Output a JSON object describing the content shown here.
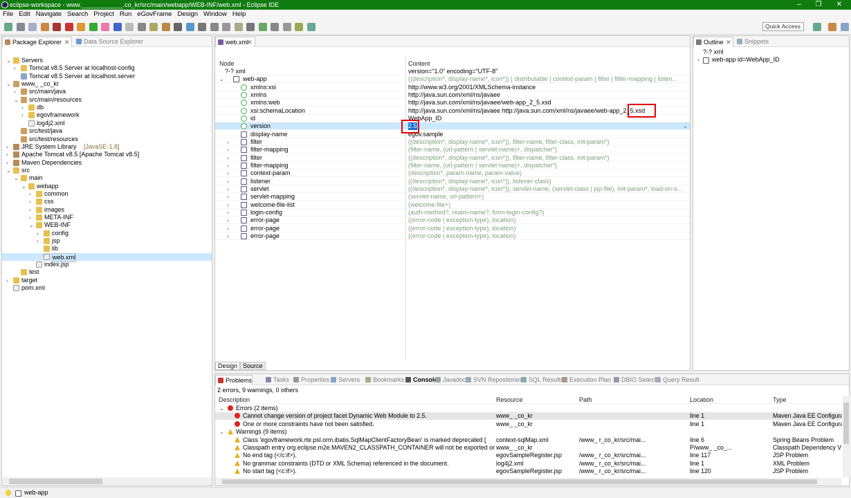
{
  "window": {
    "title": "eclipse-workspace - www.____________.co_kr/src/main/webapp/WEB-INF/web.xml - Eclipse IDE",
    "minimize": "–",
    "restore": "❐",
    "close": "✕"
  },
  "menu": [
    "File",
    "Edit",
    "Navigate",
    "Search",
    "Project",
    "Run",
    "eGovFrame",
    "Design",
    "Window",
    "Help"
  ],
  "quick_access": "Quick Access",
  "left_tabs": {
    "package_explorer": "Package Explorer",
    "data_source_explorer": "Data Source Explorer"
  },
  "tree": [
    {
      "label": "Servers",
      "indent": 0,
      "chev": "v",
      "icon": "fold"
    },
    {
      "label": "Tomcat v8.5 Server at localhost-config",
      "indent": 1,
      "chev": ">",
      "icon": "fold"
    },
    {
      "label": "Tomcat v8.5 Server at localhost.server",
      "indent": 1,
      "chev": "",
      "icon": "srv"
    },
    {
      "label": "www_              _co_kr",
      "indent": 0,
      "chev": "v",
      "icon": "pkg"
    },
    {
      "label": "src/main/java",
      "indent": 1,
      "chev": ">",
      "icon": "pkg"
    },
    {
      "label": "src/main/resources",
      "indent": 1,
      "chev": "v",
      "icon": "pkg"
    },
    {
      "label": "db",
      "indent": 2,
      "chev": ">",
      "icon": "fold"
    },
    {
      "label": "egovframework",
      "indent": 2,
      "chev": ">",
      "icon": "fold"
    },
    {
      "label": "log4j2.xml",
      "indent": 2,
      "chev": "",
      "icon": "fileic"
    },
    {
      "label": "src/test/java",
      "indent": 1,
      "chev": "",
      "icon": "pkg"
    },
    {
      "label": "src/test/resources",
      "indent": 1,
      "chev": "",
      "icon": "pkg"
    },
    {
      "label": "JRE System Library",
      "extra": "[JavaSE-1.8]",
      "indent": 0,
      "chev": ">",
      "icon": "jar"
    },
    {
      "label": "Apache Tomcat v8.5 [Apache Tomcat v8.5]",
      "indent": 0,
      "chev": ">",
      "icon": "jar"
    },
    {
      "label": "Maven Dependencies",
      "indent": 0,
      "chev": ">",
      "icon": "jar"
    },
    {
      "label": "src",
      "indent": 0,
      "chev": "v",
      "icon": "fold"
    },
    {
      "label": "main",
      "indent": 1,
      "chev": "v",
      "icon": "fold"
    },
    {
      "label": "webapp",
      "indent": 2,
      "chev": "v",
      "icon": "fold"
    },
    {
      "label": "common",
      "indent": 3,
      "chev": ">",
      "icon": "fold"
    },
    {
      "label": "css",
      "indent": 3,
      "chev": ">",
      "icon": "fold"
    },
    {
      "label": "images",
      "indent": 3,
      "chev": ">",
      "icon": "fold"
    },
    {
      "label": "META-INF",
      "indent": 3,
      "chev": ">",
      "icon": "fold"
    },
    {
      "label": "WEB-INF",
      "indent": 3,
      "chev": "v",
      "icon": "fold"
    },
    {
      "label": "config",
      "indent": 4,
      "chev": ">",
      "icon": "fold"
    },
    {
      "label": "jsp",
      "indent": 4,
      "chev": ">",
      "icon": "fold"
    },
    {
      "label": "lib",
      "indent": 4,
      "chev": "",
      "icon": "fold"
    },
    {
      "label": "web.xml",
      "indent": 4,
      "chev": "",
      "icon": "fileic",
      "selected": true
    },
    {
      "label": "index.jsp",
      "indent": 3,
      "chev": "",
      "icon": "fileic"
    },
    {
      "label": "test",
      "indent": 1,
      "chev": "",
      "icon": "fold"
    },
    {
      "label": "target",
      "indent": 0,
      "chev": ">",
      "icon": "fold"
    },
    {
      "label": "pom.xml",
      "indent": 0,
      "chev": "",
      "icon": "fileic"
    }
  ],
  "editor": {
    "tab": "web.xml",
    "col_node": "Node",
    "col_content": "Content",
    "bottom_tabs": [
      "Design",
      "Source"
    ],
    "rows": [
      {
        "node": "?-? xml",
        "content": "version=\"1.0\" encoding=\"UTF-8\"",
        "indent": 0,
        "chev": "",
        "kind": "pi"
      },
      {
        "node": "web-app",
        "content": "((description*, display-name*, icon*)) | distributable | context-param | filter | filter-mapping | listen...",
        "indent": 0,
        "chev": "v",
        "kind": "el",
        "gray": true
      },
      {
        "node": "xmlns:xsi",
        "content": "http://www.w3.org/2001/XMLSchema-instance",
        "indent": 1,
        "chev": "",
        "kind": "at"
      },
      {
        "node": "xmlns",
        "content": "http://java.sun.com/xml/ns/javaee",
        "indent": 1,
        "chev": "",
        "kind": "at"
      },
      {
        "node": "xmlns:web",
        "content": "http://java.sun.com/xml/ns/javaee/web-app_2_5.xsd",
        "indent": 1,
        "chev": "",
        "kind": "at"
      },
      {
        "node": "xsi:schemaLocation",
        "content": "http://java.sun.com/xml/ns/javaee http://java.sun.com/xml/ns/javaee/web-app_2_5.xsd",
        "indent": 1,
        "chev": "",
        "kind": "at"
      },
      {
        "node": "id",
        "content": "WebApp_ID",
        "indent": 1,
        "chev": "",
        "kind": "at"
      },
      {
        "node": "version",
        "content": "2.5",
        "indent": 1,
        "chev": "",
        "kind": "at",
        "selected": true
      },
      {
        "node": "display-name",
        "content": "egov.sample",
        "indent": 1,
        "chev": "",
        "kind": "el"
      },
      {
        "node": "filter",
        "content": "((description*, display-name*, icon*)), filter-name, filter-class, init-param*)",
        "indent": 1,
        "chev": ">",
        "kind": "el",
        "gray": true
      },
      {
        "node": "filter-mapping",
        "content": "(filter-name, (url-pattern | servlet-name)+, dispatcher*)",
        "indent": 1,
        "chev": ">",
        "kind": "el",
        "gray": true
      },
      {
        "node": "filter",
        "content": "((description*, display-name*, icon*)), filter-name, filter-class, init-param*)",
        "indent": 1,
        "chev": ">",
        "kind": "el",
        "gray": true
      },
      {
        "node": "filter-mapping",
        "content": "(filter-name, (url-pattern | servlet-name)+, dispatcher*)",
        "indent": 1,
        "chev": ">",
        "kind": "el",
        "gray": true
      },
      {
        "node": "context-param",
        "content": "(description*, param-name, param-value)",
        "indent": 1,
        "chev": ">",
        "kind": "el",
        "gray": true
      },
      {
        "node": "listener",
        "content": "((description*, display-name*, icon*)), listener-class)",
        "indent": 1,
        "chev": ">",
        "kind": "el",
        "gray": true
      },
      {
        "node": "servlet",
        "content": "((description*, display-name*, icon*)), servlet-name, (servlet-class | jsp-file), init-param*, load-on-s...",
        "indent": 1,
        "chev": ">",
        "kind": "el",
        "gray": true
      },
      {
        "node": "servlet-mapping",
        "content": "(servlet-name, url-pattern+)",
        "indent": 1,
        "chev": ">",
        "kind": "el",
        "gray": true
      },
      {
        "node": "welcome-file-list",
        "content": "(welcome-file+)",
        "indent": 1,
        "chev": ">",
        "kind": "el",
        "gray": true
      },
      {
        "node": "login-config",
        "content": "(auth-method?, realm-name?, form-login-config?)",
        "indent": 1,
        "chev": ">",
        "kind": "el",
        "gray": true
      },
      {
        "node": "error-page",
        "content": "((error-code | exception-type), location)",
        "indent": 1,
        "chev": ">",
        "kind": "el",
        "gray": true
      },
      {
        "node": "error-page",
        "content": "((error-code | exception-type), location)",
        "indent": 1,
        "chev": ">",
        "kind": "el",
        "gray": true
      },
      {
        "node": "error-page",
        "content": "((error-code | exception-type), location)",
        "indent": 1,
        "chev": ">",
        "kind": "el",
        "gray": true
      }
    ]
  },
  "outline": {
    "tab": "Outline",
    "snippets_tab": "Snippets",
    "items": [
      {
        "label": "?-? xml"
      },
      {
        "label": "web-app id=WebApp_ID"
      }
    ]
  },
  "bottom_tabs": [
    "Problems",
    "Tasks",
    "Properties",
    "Servers",
    "Bookmarks",
    "Console",
    "Javadoc",
    "SVN Repositories",
    "SQL Results",
    "Execution Plan",
    "DBIO Search",
    "Query Result"
  ],
  "problems": {
    "summary": "2 errors, 9 warnings, 0 others",
    "columns": [
      "Description",
      "Resource",
      "Path",
      "Location",
      "Type"
    ],
    "rows": [
      {
        "kind": "group-err",
        "desc": "Errors (2 items)"
      },
      {
        "kind": "err",
        "desc": "Cannot change version of project facet Dynamic Web Module to 2.5.",
        "res": "www_            _co_kr",
        "path": "",
        "loc": "line 1",
        "type": "Maven Java EE Configura",
        "selected": true
      },
      {
        "kind": "err",
        "desc": "One or more constraints have not been satisfied.",
        "res": "www_            _co_kr",
        "path": "",
        "loc": "line 1",
        "type": "Maven Java EE Configura"
      },
      {
        "kind": "group-warn",
        "desc": "Warnings (9 items)"
      },
      {
        "kind": "warn",
        "desc": "Class 'egovframework.rte.psl.orm.ibatis.SqlMapClientFactoryBean' is marked deprecated [",
        "res": "context-sqlMap.xml",
        "path": "/www_               r_co_kr/src/mai...",
        "loc": "line 6",
        "type": "Spring Beans Problem"
      },
      {
        "kind": "warn",
        "desc": "Classpath entry org.eclipse.m2e.MAVEN2_CLASSPATH_CONTAINER will not be exported or",
        "res": "www_            _co_kr",
        "path": "",
        "loc": "P/www_          _co_...",
        "type": "Classpath Dependency V"
      },
      {
        "kind": "warn",
        "desc": "No end tag (</c:if>).",
        "res": "egovSampleRegister.jsp",
        "path": "/www_               r_co_kr/src/mai...",
        "loc": "line 117",
        "type": "JSP Problem"
      },
      {
        "kind": "warn",
        "desc": "No grammar constraints (DTD or XML Schema) referenced in the document.",
        "res": "log4j2.xml",
        "path": "/www_               r_co_kr/src/mai...",
        "loc": "line 1",
        "type": "XML Problem"
      },
      {
        "kind": "warn",
        "desc": "No start tag (<c:if>).",
        "res": "egovSampleRegister.jsp",
        "path": "/www_               r_co_kr/src/mai...",
        "loc": "line 120",
        "type": "JSP Problem"
      }
    ]
  },
  "status": {
    "text": "web-app"
  }
}
